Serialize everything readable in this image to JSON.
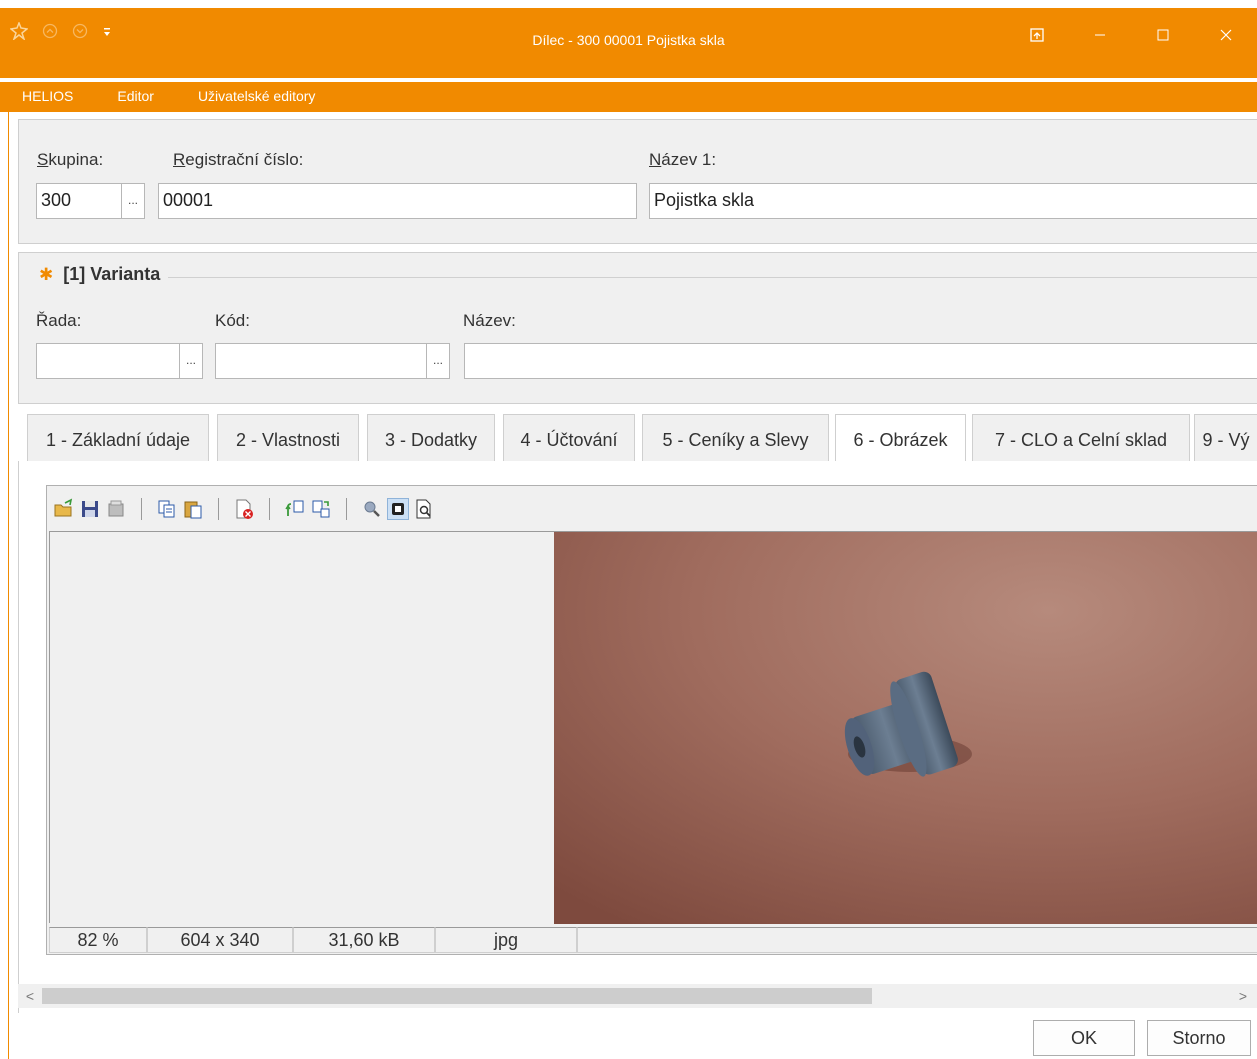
{
  "window": {
    "title": "Dílec - 300 00001 Pojistka skla",
    "accent_color": "#f18a00",
    "left_icons": [
      "app-icon",
      "back-circle-icon",
      "forward-circle-icon",
      "quick-access-dropdown-icon"
    ],
    "controls": [
      "restore-to-top-icon",
      "minimize-icon",
      "maximize-icon",
      "close-icon"
    ]
  },
  "menu": {
    "items": [
      "HELIOS",
      "Editor",
      "Uživatelské editory"
    ]
  },
  "header": {
    "skupina_label": "Skupina:",
    "skupina_value": "300",
    "registracni_label": "Registrační číslo:",
    "registracni_value": "00001",
    "nazev1_label": "Název 1:",
    "nazev1_value": "Pojistka skla",
    "ellipsis": "..."
  },
  "varianta": {
    "title": "[1] Varianta",
    "rada_label": "Řada:",
    "rada_value": "",
    "kod_label": "Kód:",
    "kod_value": "",
    "nazev_label": "Název:",
    "nazev_value": "",
    "ellipsis": "..."
  },
  "tabs": {
    "items": [
      "1 - Základní údaje",
      "2 - Vlastnosti",
      "3 - Dodatky",
      "4 - Účtování",
      "5 - Ceníky a Slevy",
      "6 - Obrázek",
      "7 - CLO a Celní sklad",
      "9 - Vý"
    ],
    "active_index": 5
  },
  "image_viewer": {
    "toolbar_icons": [
      "open-folder-icon",
      "save-icon",
      "scan-icon",
      "copy-icon",
      "paste-icon",
      "delete-image-icon",
      "rotate-left-icon",
      "rotate-right-icon",
      "zoom-icon",
      "fit-to-window-icon",
      "print-preview-icon"
    ],
    "status": {
      "zoom": "82 %",
      "dimensions": "604 x 340",
      "size": "31,60 kB",
      "format": "jpg"
    }
  },
  "buttons": {
    "ok": "OK",
    "storno": "Storno"
  },
  "scroll": {
    "left_arrow": "<",
    "right_arrow": ">"
  }
}
